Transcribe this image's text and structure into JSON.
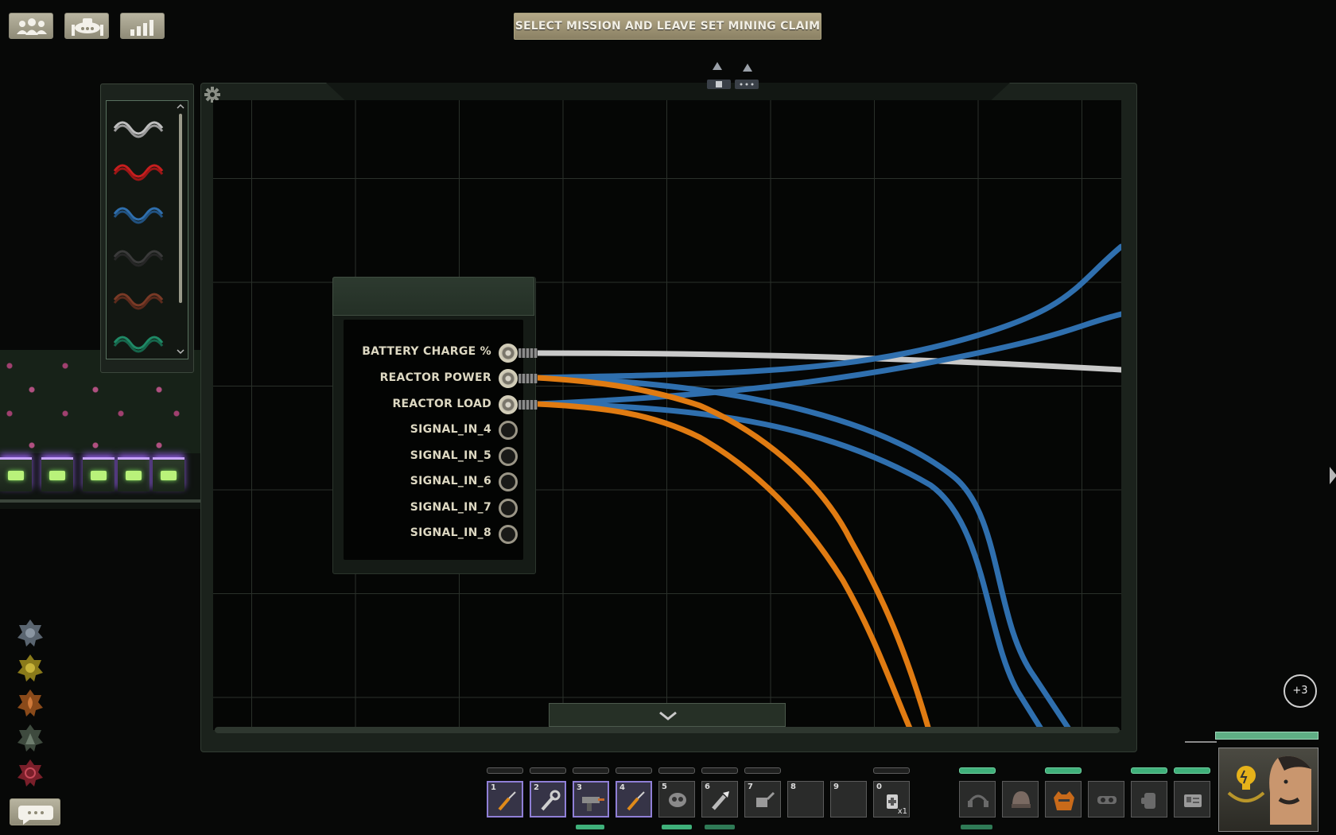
{
  "objective": {
    "label": "SELECT MISSION AND LEAVE SET MINING CLAIM"
  },
  "top_buttons": [
    {
      "name": "crew-button",
      "icon": "crew-icon"
    },
    {
      "name": "mission-button",
      "icon": "submarine-icon"
    },
    {
      "name": "stats-button",
      "icon": "bar-chart-icon"
    }
  ],
  "wire_palette": {
    "items": [
      {
        "name": "wire-gray",
        "color": "#bfbfbf"
      },
      {
        "name": "wire-red",
        "color": "#c81e1e"
      },
      {
        "name": "wire-blue",
        "color": "#2f6fae"
      },
      {
        "name": "wire-black",
        "color": "#2a2a2a"
      },
      {
        "name": "wire-brown",
        "color": "#7a3a26"
      },
      {
        "name": "wire-green",
        "color": "#1f8a66"
      }
    ]
  },
  "component": {
    "inputs": [
      {
        "label": "BATTERY CHARGE %",
        "connected": true
      },
      {
        "label": "REACTOR POWER",
        "connected": true
      },
      {
        "label": "REACTOR LOAD",
        "connected": true
      },
      {
        "label": "SIGNAL_IN_4",
        "connected": false
      },
      {
        "label": "SIGNAL_IN_5",
        "connected": false
      },
      {
        "label": "SIGNAL_IN_6",
        "connected": false
      },
      {
        "label": "SIGNAL_IN_7",
        "connected": false
      },
      {
        "label": "SIGNAL_IN_8",
        "connected": false
      }
    ]
  },
  "wires": {
    "gray": "#c9c9c9",
    "blue": "#2f6fae",
    "orange": "#e07b12"
  },
  "notification": {
    "label": "+3"
  },
  "hotbar": {
    "slots": [
      {
        "num": "1",
        "icon": "screwdriver-icon",
        "selected": true
      },
      {
        "num": "2",
        "icon": "wrench-icon",
        "selected": true
      },
      {
        "num": "3",
        "icon": "welding-tool-icon",
        "selected": true
      },
      {
        "num": "4",
        "icon": "screwdriver-icon",
        "selected": true
      },
      {
        "num": "5",
        "icon": "diving-mask-icon",
        "selected": false
      },
      {
        "num": "6",
        "icon": "flashlight-icon",
        "selected": false
      },
      {
        "num": "7",
        "icon": "watering-can-icon",
        "selected": false
      },
      {
        "num": "8",
        "icon": "",
        "selected": false
      },
      {
        "num": "9",
        "icon": "",
        "selected": false
      },
      {
        "num": "0",
        "icon": "medkit-icon",
        "selected": false,
        "count": "x1"
      }
    ]
  },
  "equipment_slots": [
    {
      "icon": "headset-icon"
    },
    {
      "icon": "helmet-icon"
    },
    {
      "icon": "orange-vest-icon"
    },
    {
      "icon": "goggles-icon"
    },
    {
      "icon": "glove-icon"
    },
    {
      "icon": "id-card-icon"
    }
  ],
  "character": {
    "icon": "character-portrait",
    "job_icon": "engineer-lightbulb-icon"
  }
}
